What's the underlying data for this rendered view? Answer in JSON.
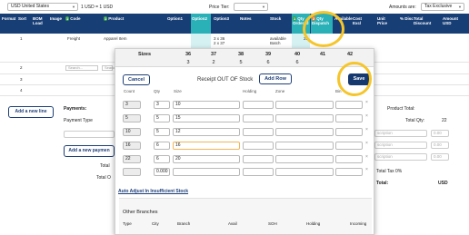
{
  "toolbar": {
    "currency": "USD United States",
    "rate": "1 USD = 1 USD",
    "price_tier_label": "Price Tier:",
    "amounts_label": "Amounts are:",
    "amounts_value": "Tax Exclusive"
  },
  "table_header": {
    "format": "Format",
    "sort": "Sort",
    "bom_load": "BOM Load",
    "image": "Image",
    "code_pill": "1",
    "code": "Code",
    "product_pill": "1",
    "product": "Product",
    "option1": "Option1",
    "option2": "Option2",
    "option3": "Option3",
    "notes": "Notes",
    "stock": "Stock",
    "qty_ordered_pill": "1",
    "qty_ordered": "Qty Ordered",
    "qty_dispatch_pill": "2",
    "qty_dispatch": "Qty Dispatch",
    "available": "Available",
    "cost_excl": "Cost Excl",
    "unit_price": "Unit Price",
    "pct_disc": "% Disc",
    "total_discount": "Total Discount",
    "amount_usd": "Amount USD"
  },
  "grid": {
    "row1": {
      "num": "1",
      "code": "Freight",
      "product": "Apparel Item",
      "option3": "3 x 36\n2 x 37",
      "stock": "available\nBatch",
      "qty": "22"
    },
    "row2": {
      "num": "2",
      "code_ph": "Search...",
      "product_ph": "Search..."
    },
    "row3": {
      "num": "3"
    },
    "row4": {
      "num": "4"
    }
  },
  "left_panel": {
    "add_line": "Add a new line",
    "payments": "Payments:",
    "payment_type": "Payment Type",
    "add_payment": "Add a new paymen",
    "total": "Total",
    "total_o": "Total O"
  },
  "right_panel": {
    "product_total": "Product Total:",
    "total_qty_label": "Total Qty:",
    "total_qty": "22",
    "description_ph": "scription",
    "amount_ph": "0.00",
    "total_tax": "Total Tax 0%",
    "total": "Total:",
    "currency": "USD"
  },
  "modal": {
    "sizes_label": "Sizes",
    "sizes": [
      "36",
      "37",
      "38",
      "39",
      "40",
      "41",
      "42"
    ],
    "size_counts": [
      "3",
      "2",
      "5",
      "6",
      "6",
      "",
      ""
    ],
    "cancel": "Cancel",
    "title": "Receipt OUT OF Stock",
    "add_row": "Add Row",
    "save": "Save",
    "columns": {
      "count": "Count",
      "qty": "Qty",
      "size": "Size",
      "holding": "Holding",
      "zone": "Zone",
      "bin": "Bin"
    },
    "rows": [
      {
        "count": "3",
        "qty": "3",
        "size": "10"
      },
      {
        "count": "5",
        "qty": "5",
        "size": "15"
      },
      {
        "count": "10",
        "qty": "5",
        "size": "12"
      },
      {
        "count": "16",
        "qty": "6",
        "size": "16"
      },
      {
        "count": "22",
        "qty": "6",
        "size": "20"
      },
      {
        "count": "",
        "qty": "0.000",
        "size": ""
      }
    ],
    "auto_adjust": "Auto Adjust In Insufficient Stock",
    "branches_title": "Other Branches",
    "branches_cols": [
      "Type",
      "City",
      "Branch",
      "Avail",
      "SOH",
      "Holding",
      "Incoming"
    ]
  },
  "colors": {
    "header_bg": "#183e76",
    "teal": "#2ab0b7",
    "save_bg": "#15386f",
    "highlight": "#f5c52a",
    "pill_green": "#37a24a",
    "pill_orange": "#ee7a2a"
  }
}
